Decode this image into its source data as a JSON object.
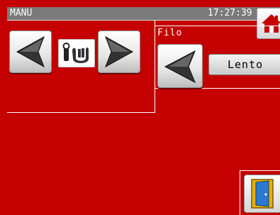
{
  "header": {
    "mode": "MANU",
    "clock": "17:27:39"
  },
  "icons": {
    "home": "home-icon",
    "prev": "arrow-left-icon",
    "next": "arrow-right-icon",
    "mode": "manual-mode-icon",
    "exit": "exit-door-icon"
  },
  "filo": {
    "label": "Filo",
    "speed_value": "Lento"
  },
  "colors": {
    "background": "#c40000",
    "titlebar": "#7a7a7a",
    "home_roof": "#c40000"
  }
}
